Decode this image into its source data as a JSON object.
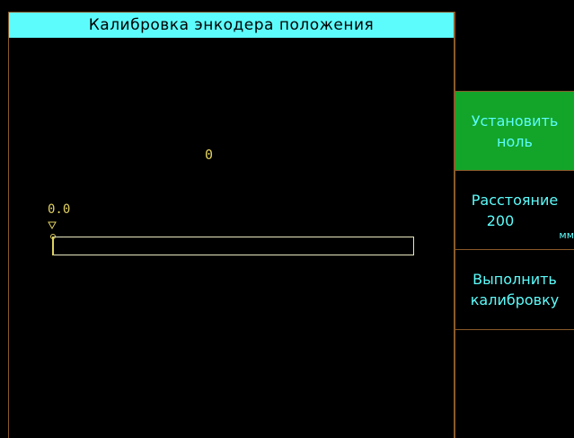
{
  "title": "Калибровка энкодера положения",
  "counter_value": "0",
  "position_label": "0.0",
  "colors": {
    "background": "#000000",
    "title_bar": "#5dfcfc",
    "accent_text": "#5dfcfc",
    "active_button": "#13a52a",
    "value_text": "#e0d060",
    "border": "#8a5a2a"
  },
  "side_menu": {
    "set_zero": {
      "line1": "Установить",
      "line2": "ноль"
    },
    "distance": {
      "label": "Расстояние",
      "value": "200",
      "unit": "мм"
    },
    "calibrate": {
      "line1": "Выполнить",
      "line2": "калибровку"
    }
  }
}
